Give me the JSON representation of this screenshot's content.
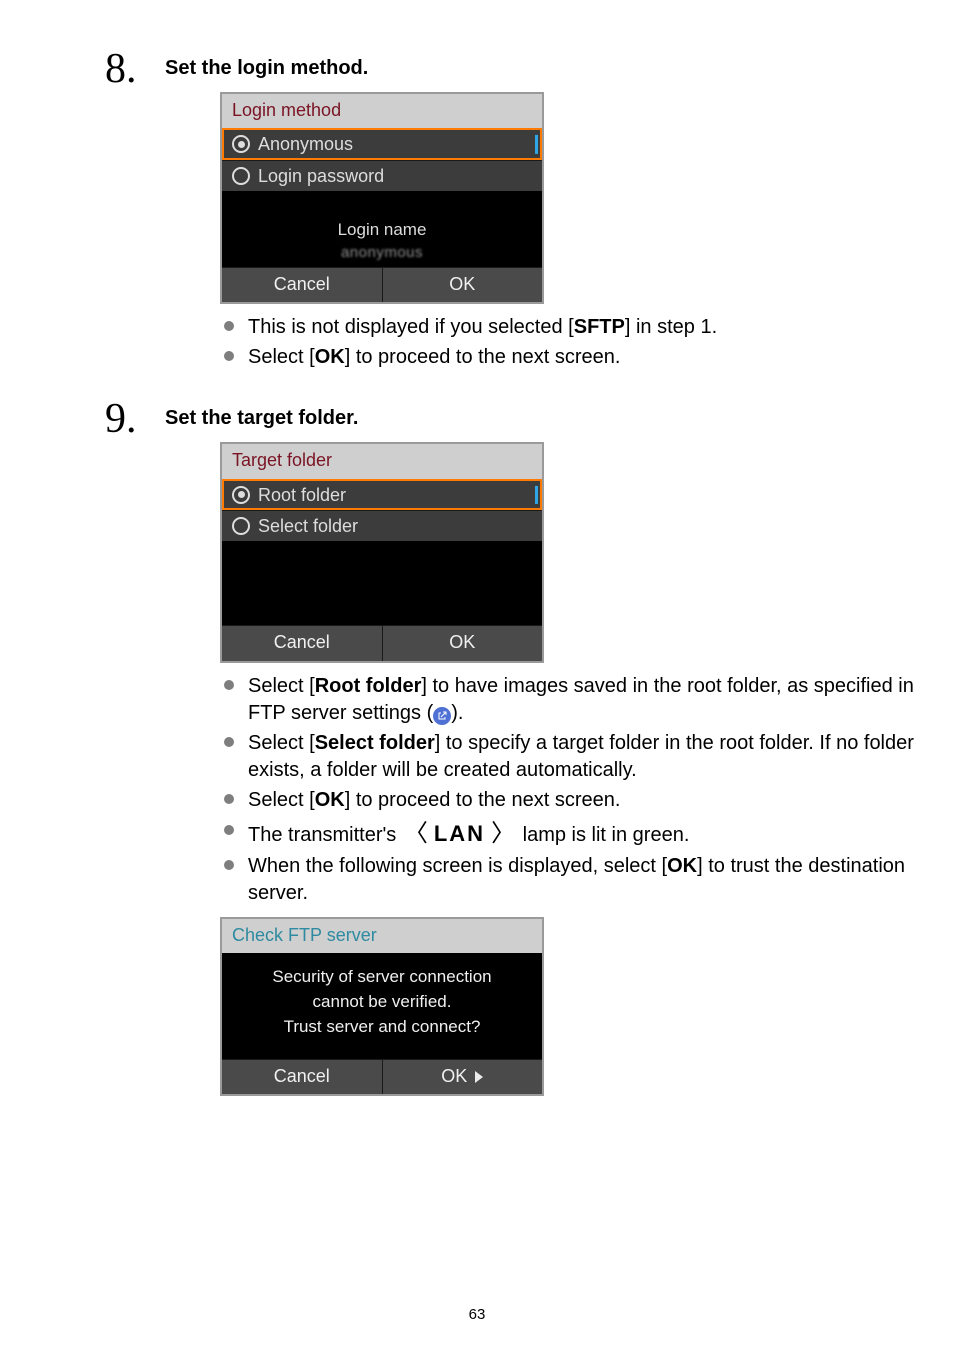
{
  "page_number": "63",
  "step8": {
    "number": "8.",
    "title": "Set the login method.",
    "panel": {
      "title": "Login method",
      "options": [
        "Anonymous",
        "Login password"
      ],
      "selected_index": 0,
      "login_name_label": "Login name",
      "login_name_value": "anonymous",
      "cancel": "Cancel",
      "ok": "OK"
    },
    "bullets": {
      "b1_pre": "This is not displayed if you selected [",
      "b1_bold": "SFTP",
      "b1_post": "] in step 1.",
      "b2_pre": "Select [",
      "b2_bold": "OK",
      "b2_post": "] to proceed to the next screen."
    }
  },
  "step9": {
    "number": "9.",
    "title": "Set the target folder.",
    "panel": {
      "title": "Target folder",
      "options": [
        "Root folder",
        "Select folder"
      ],
      "selected_index": 0,
      "cancel": "Cancel",
      "ok": "OK"
    },
    "bullets": {
      "b1_pre": "Select [",
      "b1_bold": "Root folder",
      "b1_post1": "] to have images saved in the root folder, as specified in FTP server settings (",
      "b1_post2": ").",
      "b2_pre": "Select [",
      "b2_bold": "Select folder",
      "b2_post": "] to specify a target folder in the root folder. If no folder exists, a folder will be created automatically.",
      "b3_pre": "Select [",
      "b3_bold": "OK",
      "b3_post": "] to proceed to the next screen.",
      "b4_pre": "The transmitter's  ",
      "b4_lan": "LAN",
      "b4_post": "  lamp is lit in green.",
      "b5_pre": "When the following screen is displayed, select [",
      "b5_bold": "OK",
      "b5_post": "] to trust the destination server."
    },
    "check_panel": {
      "title": "Check FTP server",
      "line1": "Security of server connection",
      "line2": "cannot be verified.",
      "line3": "Trust server and connect?",
      "cancel": "Cancel",
      "ok": "OK"
    }
  }
}
